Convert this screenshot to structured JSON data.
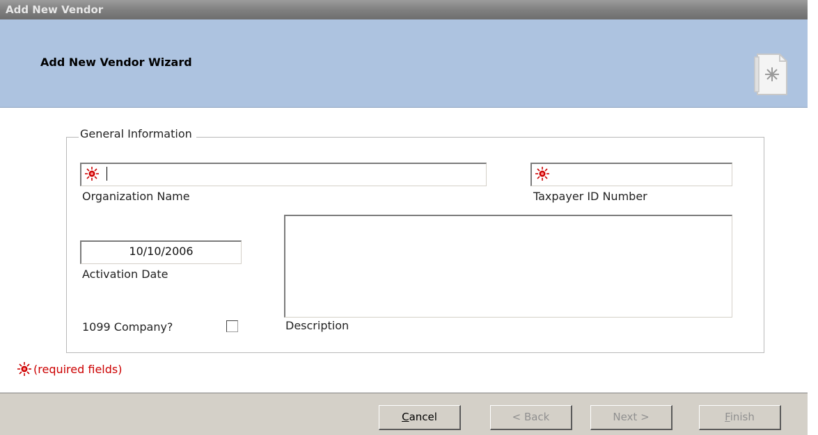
{
  "window": {
    "title": "Add New Vendor"
  },
  "header": {
    "title": "Add New Vendor Wizard",
    "icon": "wizard-document-icon"
  },
  "group": {
    "legend": "General Information"
  },
  "fields": {
    "organization_name": {
      "label": "Organization Name",
      "value": "",
      "required": true
    },
    "taxpayer_id": {
      "label": "Taxpayer ID Number",
      "value": "",
      "required": true
    },
    "activation_date": {
      "label": "Activation Date",
      "value": "10/10/2006"
    },
    "description": {
      "label": "Description",
      "value": ""
    },
    "company_1099": {
      "label": "1099 Company?",
      "checked": false
    }
  },
  "required_note": "(required fields)",
  "buttons": {
    "cancel_prefix": "",
    "cancel_mnemonic": "C",
    "cancel_rest": "ancel",
    "back": "< Back",
    "next": "Next >",
    "finish_prefix": "",
    "finish_mnemonic": "F",
    "finish_rest": "inish"
  },
  "colors": {
    "header_bg": "#adc3e0",
    "required_red": "#cc0000",
    "footer_bg": "#d4d0c8"
  }
}
